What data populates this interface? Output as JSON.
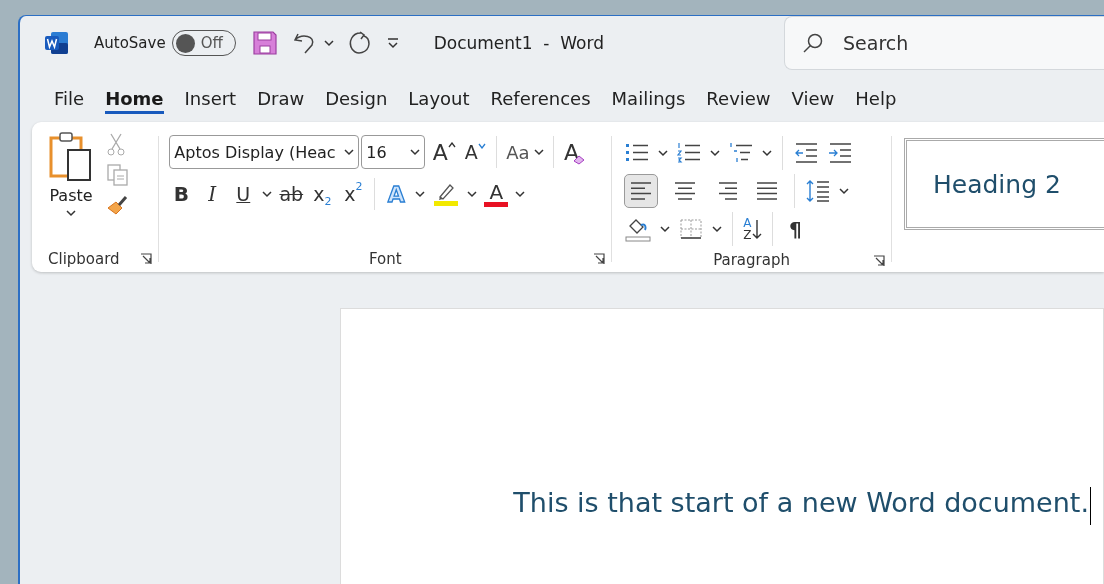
{
  "title_bar": {
    "autosave_label": "AutoSave",
    "autosave": {
      "on": false,
      "label": "Off"
    },
    "document_title": "Document1  -  Word",
    "search": {
      "placeholder": "Search"
    }
  },
  "tabs": [
    {
      "label": "File",
      "selected": false
    },
    {
      "label": "Home",
      "selected": true
    },
    {
      "label": "Insert",
      "selected": false
    },
    {
      "label": "Draw",
      "selected": false
    },
    {
      "label": "Design",
      "selected": false
    },
    {
      "label": "Layout",
      "selected": false
    },
    {
      "label": "References",
      "selected": false
    },
    {
      "label": "Mailings",
      "selected": false
    },
    {
      "label": "Review",
      "selected": false
    },
    {
      "label": "View",
      "selected": false
    },
    {
      "label": "Help",
      "selected": false
    }
  ],
  "clipboard": {
    "paste": "Paste",
    "label": "Clipboard"
  },
  "font": {
    "font_name": "Aptos Display (Heac",
    "font_size": "16",
    "grow": "A",
    "shrink": "A",
    "change_case": "Aa",
    "clear_formatting": "A",
    "bold": "B",
    "italic": "I",
    "underline": "U",
    "strikethrough": "ab",
    "subscript": {
      "base": "x",
      "index": "2"
    },
    "superscript": {
      "base": "x",
      "index": "2"
    },
    "text_effects": "A",
    "font_color": "A",
    "label": "Font"
  },
  "paragraph": {
    "alignment": [
      {
        "kind": "left",
        "selected": true
      },
      {
        "kind": "center",
        "selected": false
      },
      {
        "kind": "right",
        "selected": false
      },
      {
        "kind": "justify",
        "selected": false
      }
    ],
    "sort_top": "A",
    "sort_bottom": "Z",
    "show_marks": "¶",
    "label": "Paragraph"
  },
  "styles": [
    {
      "label": "Heading 2"
    }
  ],
  "document": {
    "text": "This is that start of a new Word document."
  }
}
